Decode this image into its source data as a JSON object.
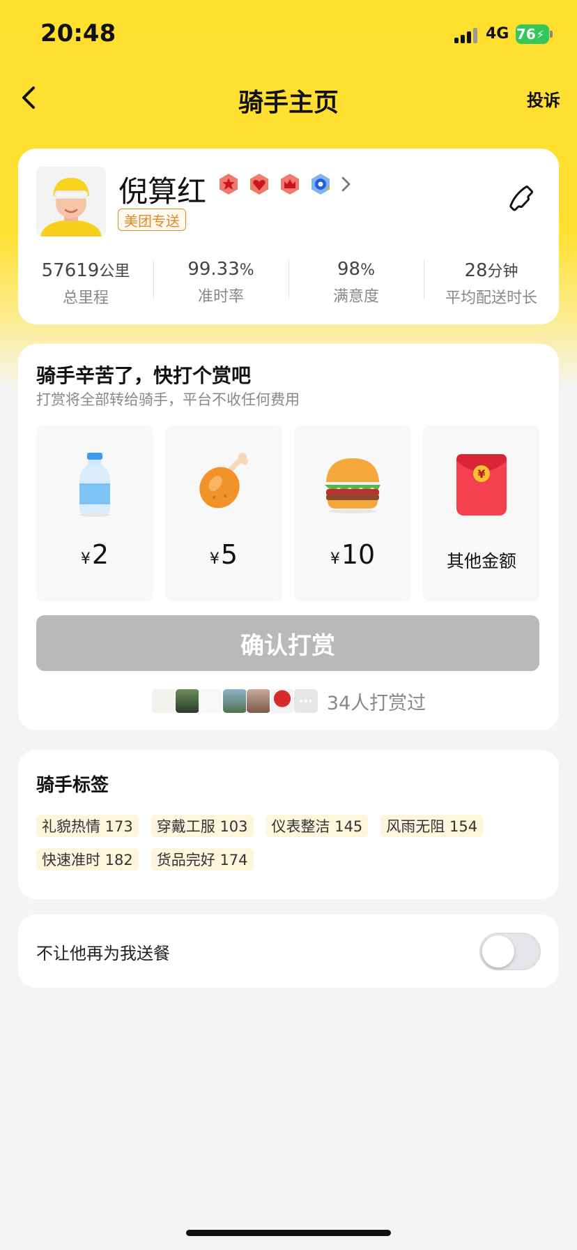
{
  "status_bar": {
    "time": "20:48",
    "network": "4G",
    "battery": "76"
  },
  "nav": {
    "title": "骑手主页",
    "complain": "投诉"
  },
  "rider": {
    "name": "倪算红",
    "brand_tag": "美团专送",
    "badges": [
      "star-badge-icon",
      "heart-badge-icon",
      "crown-badge-icon",
      "blue-gear-badge-icon"
    ],
    "stats": [
      {
        "value": "57619",
        "unit": "公里",
        "label": "总里程"
      },
      {
        "value": "99.33",
        "unit": "%",
        "label": "准时率"
      },
      {
        "value": "98",
        "unit": "%",
        "label": "满意度"
      },
      {
        "value": "28",
        "unit": "分钟",
        "label": "平均配送时长"
      }
    ]
  },
  "tip": {
    "title": "骑手辛苦了，快打个赏吧",
    "subtitle": "打赏将全部转给骑手，平台不收任何费用",
    "currency": "¥",
    "options": [
      {
        "icon": "water-bottle-icon",
        "amount": "2"
      },
      {
        "icon": "chicken-leg-icon",
        "amount": "5"
      },
      {
        "icon": "burger-icon",
        "amount": "10"
      },
      {
        "icon": "red-envelope-icon",
        "label": "其他金额"
      }
    ],
    "confirm_label": "确认打赏",
    "tippers_text": "34人打赏过"
  },
  "tags": {
    "title": "骑手标签",
    "items": [
      "礼貌热情 173",
      "穿戴工服 103",
      "仪表整洁 145",
      "风雨无阻 154",
      "快速准时 182",
      "货品完好 174"
    ]
  },
  "block": {
    "label": "不让他再为我送餐",
    "enabled": false
  }
}
